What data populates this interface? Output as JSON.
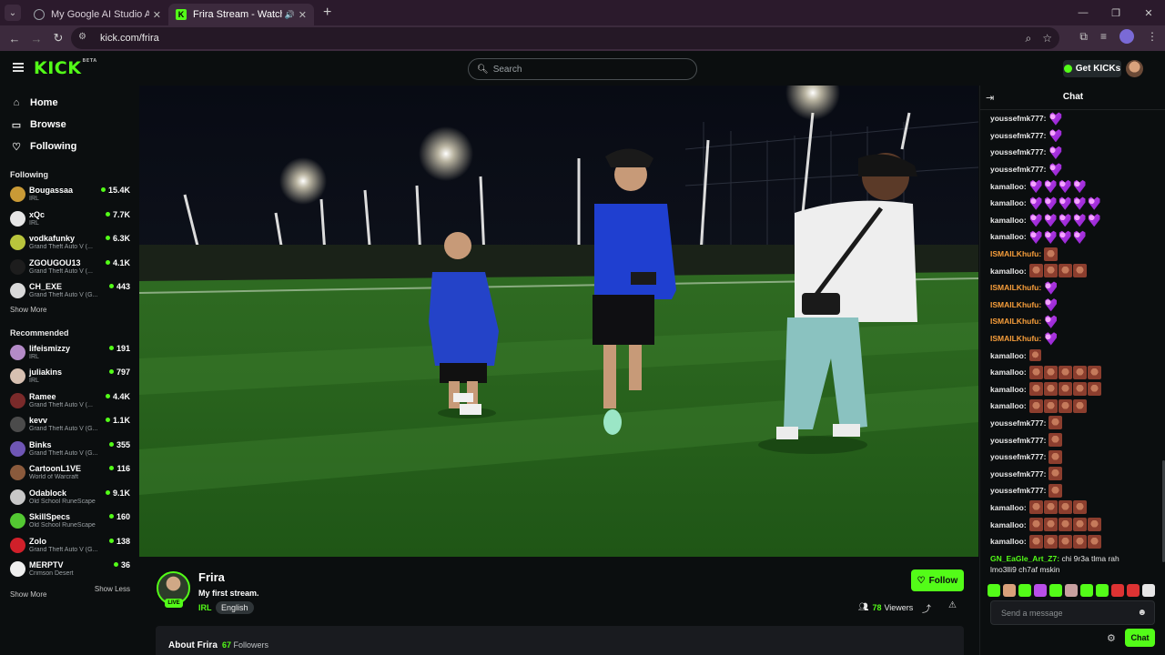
{
  "browser": {
    "tabs": [
      {
        "title": "My Google AI Studio App",
        "active": false
      },
      {
        "title": "Frira Stream - Watch Live on Kick",
        "active": true
      }
    ],
    "url": "kick.com/frira"
  },
  "header": {
    "logo": "KICK",
    "logo_badge": "BETA",
    "search_placeholder": "Search",
    "get_kicks_label": "Get KICKs"
  },
  "sidebar": {
    "nav": [
      {
        "label": "Home",
        "icon": "home-icon"
      },
      {
        "label": "Browse",
        "icon": "browse-icon"
      },
      {
        "label": "Following",
        "icon": "heart-icon"
      }
    ],
    "following_title": "Following",
    "following": [
      {
        "name": "Bougassaa",
        "category": "IRL",
        "viewers": "15.4K",
        "color": "#c99a36"
      },
      {
        "name": "xQc",
        "category": "IRL",
        "viewers": "7.7K",
        "color": "#e6e6e6"
      },
      {
        "name": "vodkafunky",
        "category": "Grand Theft Auto V (...",
        "viewers": "6.3K",
        "color": "#b8c43c"
      },
      {
        "name": "ZGOUGOU13",
        "category": "Grand Theft Auto V (...",
        "viewers": "4.1K",
        "color": "#1d1d1d"
      },
      {
        "name": "CH_EXE",
        "category": "Grand Theft Auto V (G...",
        "viewers": "443",
        "color": "#d9d9d9"
      }
    ],
    "show_more_following": "Show More",
    "recommended_title": "Recommended",
    "recommended": [
      {
        "name": "lifeismizzy",
        "category": "IRL",
        "viewers": "191",
        "color": "#b48bc7"
      },
      {
        "name": "juliakins",
        "category": "IRL",
        "viewers": "797",
        "color": "#d7c0b1"
      },
      {
        "name": "Ramee",
        "category": "Grand Theft Auto V (...",
        "viewers": "4.4K",
        "color": "#7a2a2a"
      },
      {
        "name": "kevv",
        "category": "Grand Theft Auto V (G...",
        "viewers": "1.1K",
        "color": "#4b4b4b"
      },
      {
        "name": "Binks",
        "category": "Grand Theft Auto V (G...",
        "viewers": "355",
        "color": "#6f56b5"
      },
      {
        "name": "CartoonL1VE",
        "category": "World of Warcraft",
        "viewers": "116",
        "color": "#8a5a3c"
      },
      {
        "name": "Odablock",
        "category": "Old School RuneScape",
        "viewers": "9.1K",
        "color": "#c8c8c8"
      },
      {
        "name": "SkillSpecs",
        "category": "Old School RuneScape",
        "viewers": "160",
        "color": "#53c832"
      },
      {
        "name": "Zolo",
        "category": "Grand Theft Auto V (G...",
        "viewers": "138",
        "color": "#d0202a"
      },
      {
        "name": "MERPTV",
        "category": "Crimson Desert",
        "viewers": "36",
        "color": "#efefef"
      }
    ],
    "show_more": "Show More",
    "show_less": "Show Less"
  },
  "stream": {
    "live_badge": "LIVE",
    "name": "Frira",
    "title": "My first stream.",
    "category": "IRL",
    "language": "English",
    "follow_label": "Follow",
    "viewers": "78",
    "viewers_label": "Viewers",
    "about_title": "About Frira",
    "followers": "67",
    "followers_label": "Followers"
  },
  "chat": {
    "title": "Chat",
    "messages": [
      {
        "user": "youssefmk777:",
        "color": "white",
        "emotes": [
          "heart"
        ]
      },
      {
        "user": "youssefmk777:",
        "color": "white",
        "emotes": [
          "heart"
        ]
      },
      {
        "user": "youssefmk777:",
        "color": "white",
        "emotes": [
          "heart"
        ]
      },
      {
        "user": "youssefmk777:",
        "color": "white",
        "emotes": [
          "heart"
        ]
      },
      {
        "user": "kamalloo:",
        "color": "white",
        "emotes": [
          "heart",
          "heart",
          "heart",
          "heart"
        ]
      },
      {
        "user": "kamalloo:",
        "color": "white",
        "emotes": [
          "heart",
          "heart",
          "heart",
          "heart",
          "heart"
        ]
      },
      {
        "user": "kamalloo:",
        "color": "white",
        "emotes": [
          "heart",
          "heart",
          "heart",
          "heart",
          "heart"
        ]
      },
      {
        "user": "kamalloo:",
        "color": "white",
        "emotes": [
          "heart",
          "heart",
          "heart",
          "heart"
        ]
      },
      {
        "user": "ISMAILKhufu:",
        "color": "orange",
        "emotes": [
          "face"
        ]
      },
      {
        "user": "kamalloo:",
        "color": "white",
        "emotes": [
          "face",
          "face",
          "face",
          "face"
        ]
      },
      {
        "user": "ISMAILKhufu:",
        "color": "orange",
        "emotes": [
          "heart"
        ]
      },
      {
        "user": "ISMAILKhufu:",
        "color": "orange",
        "emotes": [
          "heart"
        ]
      },
      {
        "user": "ISMAILKhufu:",
        "color": "orange",
        "emotes": [
          "heart"
        ]
      },
      {
        "user": "ISMAILKhufu:",
        "color": "orange",
        "emotes": [
          "heart"
        ]
      },
      {
        "user": "kamalloo:",
        "color": "white",
        "emotes": [
          "small"
        ]
      },
      {
        "user": "kamalloo:",
        "color": "white",
        "emotes": [
          "face",
          "face",
          "face",
          "face",
          "face"
        ]
      },
      {
        "user": "kamalloo:",
        "color": "white",
        "emotes": [
          "face",
          "face",
          "face",
          "face",
          "face"
        ]
      },
      {
        "user": "kamalloo:",
        "color": "white",
        "emotes": [
          "face",
          "face",
          "face",
          "face"
        ]
      },
      {
        "user": "youssefmk777:",
        "color": "white",
        "emotes": [
          "face"
        ]
      },
      {
        "user": "youssefmk777:",
        "color": "white",
        "emotes": [
          "face"
        ]
      },
      {
        "user": "youssefmk777:",
        "color": "white",
        "emotes": [
          "face"
        ]
      },
      {
        "user": "youssefmk777:",
        "color": "white",
        "emotes": [
          "face"
        ]
      },
      {
        "user": "youssefmk777:",
        "color": "white",
        "emotes": [
          "face"
        ]
      },
      {
        "user": "kamalloo:",
        "color": "white",
        "emotes": [
          "face",
          "face",
          "face",
          "face"
        ]
      },
      {
        "user": "kamalloo:",
        "color": "white",
        "emotes": [
          "face",
          "face",
          "face",
          "face",
          "face"
        ]
      },
      {
        "user": "kamalloo:",
        "color": "white",
        "emotes": [
          "face",
          "face",
          "face",
          "face",
          "face"
        ]
      }
    ],
    "last_message_user": "GN_EaGle_Art_Z7:",
    "last_message_text": "chi 9r3a tlma rah lmo3lli9 ch7af mskin",
    "emote_bar": [
      "#53fc18",
      "#d9a07a",
      "#53fc18",
      "#b84ee8",
      "#53fc18",
      "#c8a0a0",
      "#53fc18",
      "#53fc18",
      "#d33",
      "#d33",
      "#e6e6e6"
    ],
    "input_placeholder": "Send a message",
    "send_label": "Chat"
  },
  "colors": {
    "accent": "#53fc18",
    "background": "#0b0e0f"
  }
}
